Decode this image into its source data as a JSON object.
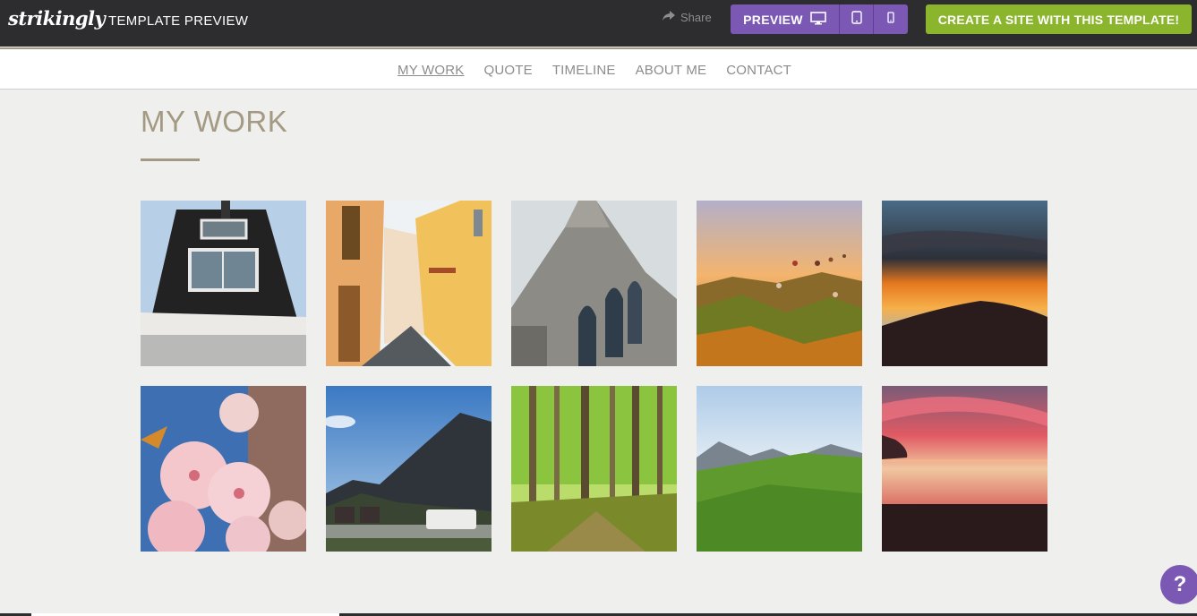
{
  "topbar": {
    "logo": "strikingly",
    "title": "TEMPLATE PREVIEW",
    "share_label": "Share",
    "preview_label": "PREVIEW",
    "create_label": "CREATE A SITE WITH THIS TEMPLATE!",
    "icons": {
      "share": "share-arrow-icon",
      "desktop": "desktop-icon",
      "tablet": "tablet-icon",
      "mobile": "mobile-icon"
    }
  },
  "nav": {
    "items": [
      {
        "label": "MY WORK",
        "active": true
      },
      {
        "label": "QUOTE"
      },
      {
        "label": "TIMELINE"
      },
      {
        "label": "ABOUT ME"
      },
      {
        "label": "CONTACT"
      }
    ]
  },
  "section": {
    "title": "MY WORK"
  },
  "gallery": {
    "tiles": [
      {
        "subject": "building-facade"
      },
      {
        "subject": "yellow-street"
      },
      {
        "subject": "gothic-church"
      },
      {
        "subject": "hot-air-balloons"
      },
      {
        "subject": "sunset-hill"
      },
      {
        "subject": "pink-blossoms"
      },
      {
        "subject": "mountain-camper"
      },
      {
        "subject": "green-forest"
      },
      {
        "subject": "grassy-meadow"
      },
      {
        "subject": "pink-sunset-beach"
      }
    ]
  },
  "help": {
    "label": "?"
  },
  "colors": {
    "topbar": "#2d2d2f",
    "purple": "#7b58b3",
    "green": "#8ab52d",
    "accent": "#a49a83",
    "page_bg": "#efefed"
  }
}
